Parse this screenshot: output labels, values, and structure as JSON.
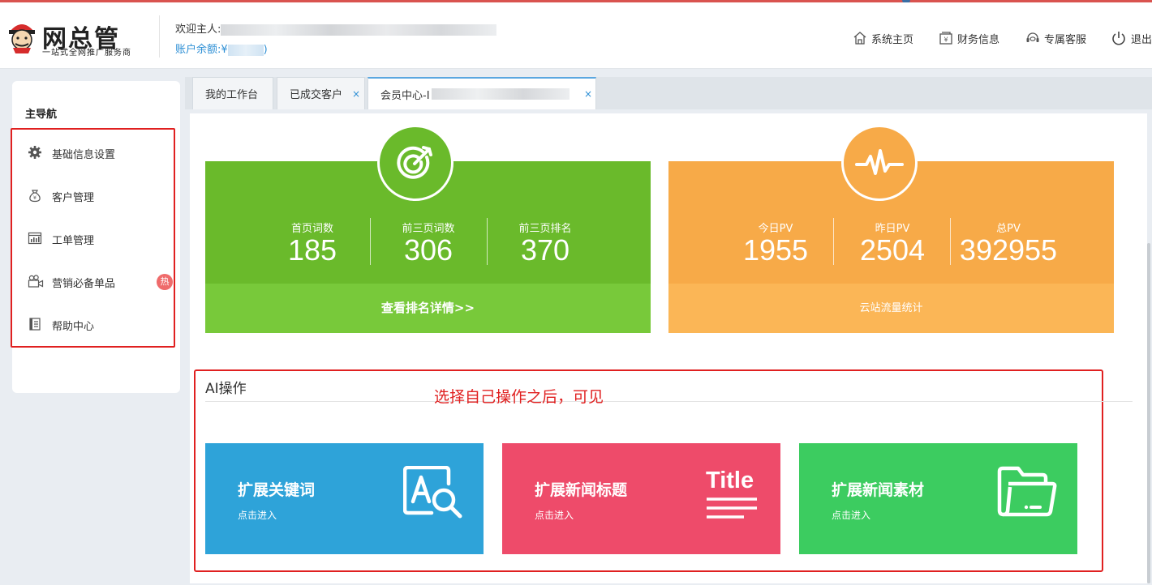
{
  "header": {
    "brand": "网总管",
    "slogan": "一站式全网推广服务商",
    "welcome_label": "欢迎主人:",
    "balance_label": "账户余额:",
    "balance_prefix": "¥",
    "balance_suffix": ")",
    "nav": [
      {
        "label": "系统主页",
        "icon": "home-icon"
      },
      {
        "label": "财务信息",
        "icon": "finance-icon"
      },
      {
        "label": "专属客服",
        "icon": "headset-icon"
      },
      {
        "label": "退出",
        "icon": "power-icon"
      }
    ]
  },
  "sidebar": {
    "title": "主导航",
    "items": [
      {
        "label": "基础信息设置",
        "icon": "gear-icon"
      },
      {
        "label": "客户管理",
        "icon": "money-bag-icon"
      },
      {
        "label": "工单管理",
        "icon": "chart-icon"
      },
      {
        "label": "营销必备单品",
        "icon": "video-camera-icon",
        "badge": "热"
      },
      {
        "label": "帮助中心",
        "icon": "book-icon"
      }
    ]
  },
  "tabs": [
    {
      "label": "我的工作台",
      "closable": false
    },
    {
      "label": "已成交客户",
      "closable": true
    },
    {
      "label": "会员中心-I",
      "closable": true,
      "active": true
    }
  ],
  "close_glyph": "×",
  "ranking_card": {
    "icon": "target-icon",
    "stats": [
      {
        "label": "首页词数",
        "value": "185"
      },
      {
        "label": "前三页词数",
        "value": "306"
      },
      {
        "label": "前三页排名",
        "value": "370"
      }
    ],
    "footer": "查看排名详情>>",
    "colors": {
      "main": "#6aba2b",
      "footer": "#78c93a"
    }
  },
  "traffic_card": {
    "icon": "pulse-icon",
    "stats": [
      {
        "label": "今日PV",
        "value": "1955"
      },
      {
        "label": "昨日PV",
        "value": "2504"
      },
      {
        "label": "总PV",
        "value": "392955"
      }
    ],
    "footer": "云站流量统计",
    "colors": {
      "main": "#f7aa48",
      "footer": "#fbb656"
    }
  },
  "ai_section": {
    "title": "AI操作",
    "note": "选择自己操作之后，可见",
    "tiles": [
      {
        "title": "扩展关键词",
        "subtitle": "点击进入",
        "icon": "search-text-icon",
        "color": "#2ea3d9"
      },
      {
        "title": "扩展新闻标题",
        "subtitle": "点击进入",
        "icon": "title-icon",
        "icon_text": "Title",
        "color": "#ee4b6a"
      },
      {
        "title": "扩展新闻素材",
        "subtitle": "点击进入",
        "icon": "folder-icon",
        "color": "#3ccc60"
      }
    ]
  }
}
